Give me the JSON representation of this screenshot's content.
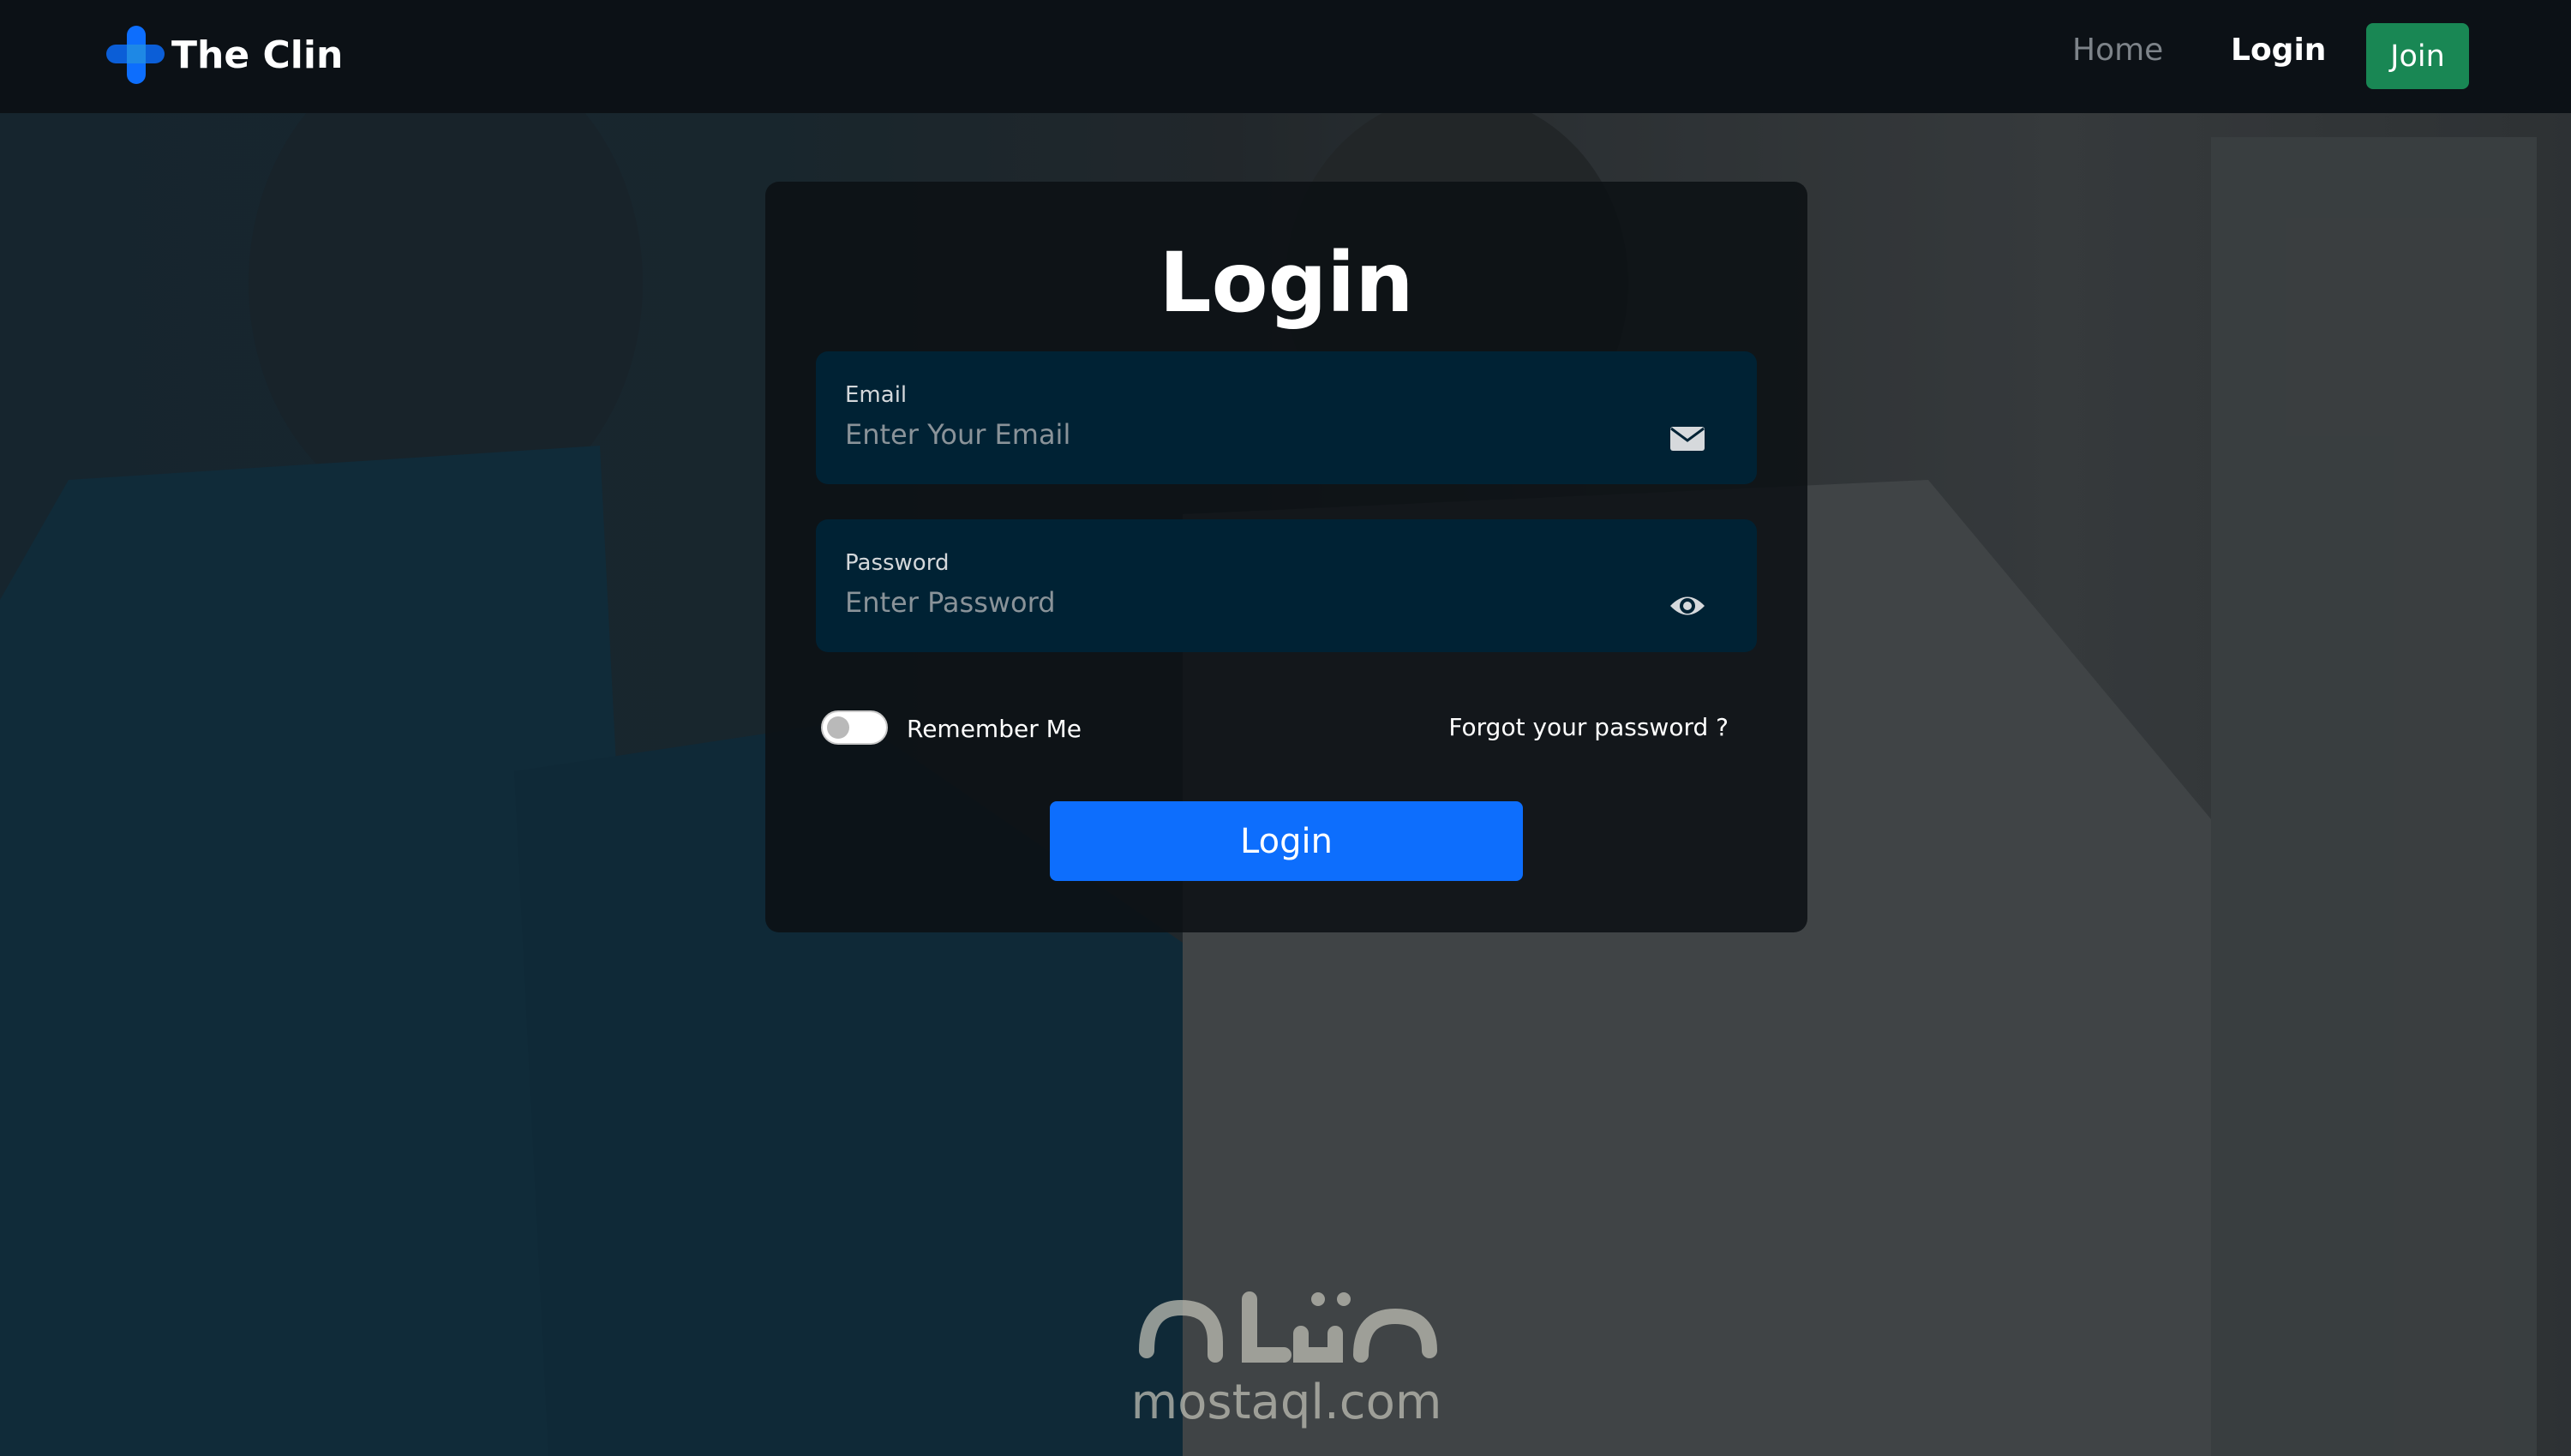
{
  "navbar": {
    "brand_name": "The Clin",
    "links": [
      {
        "label": "Home"
      },
      {
        "label": "Login"
      }
    ],
    "join_label": "Join"
  },
  "login_card": {
    "title": "Login",
    "email": {
      "label": "Email",
      "placeholder": "Enter Your Email",
      "value": "",
      "icon": "envelope-icon"
    },
    "password": {
      "label": "Password",
      "placeholder": "Enter Password",
      "value": "",
      "icon": "eye-icon"
    },
    "remember_label": "Remember Me",
    "remember_checked": false,
    "forgot_label": "Forgot your password ?",
    "submit_label": "Login"
  },
  "watermark": {
    "text": "mostaql.com",
    "logo_text": "مستقل"
  },
  "colors": {
    "navbar_bg": "#0c1116",
    "field_bg": "#002234",
    "primary": "#0d6efd",
    "success": "#198754"
  }
}
